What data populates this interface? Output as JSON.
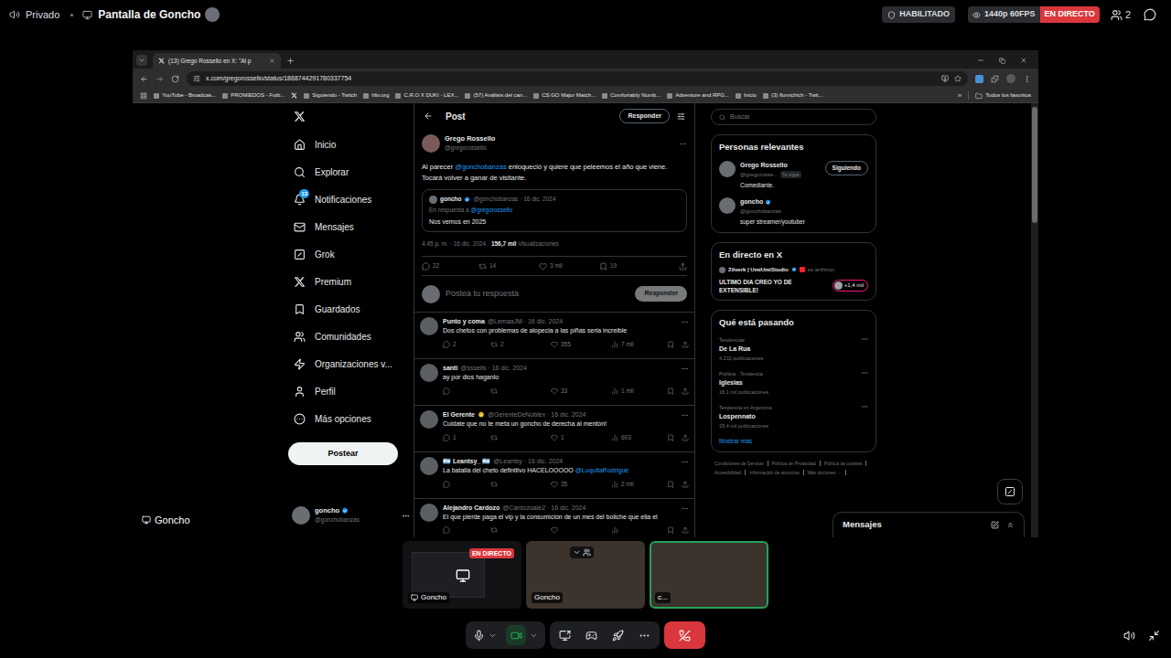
{
  "topbar": {
    "privacy": "Privado",
    "title": "Pantalla de Goncho",
    "enabled_badge": "HABILITADO",
    "quality": "1440p 60FPS",
    "live": "EN DIRECTO",
    "participants": "2"
  },
  "browser": {
    "tab": {
      "title": "(13) Grego Rossello en X: \"Al p",
      "selected": true
    },
    "url": "x.com/gregorossello/status/1868744291780337754",
    "bookmarks": [
      {
        "kind": "link",
        "label": "YouTube - Broadcas..."
      },
      {
        "kind": "link",
        "label": "PROMIEDOS - Futb..."
      },
      {
        "kind": "icon"
      },
      {
        "kind": "link",
        "label": "Siguiendo - Twitch"
      },
      {
        "kind": "link",
        "label": "hltv.org"
      },
      {
        "kind": "link",
        "label": "C.R.O X DUKI - LEX..."
      },
      {
        "kind": "link",
        "label": "(57) Análisis del can..."
      },
      {
        "kind": "link",
        "label": "CS:GO Major Match..."
      },
      {
        "kind": "link",
        "label": "Comfortably Numb..."
      },
      {
        "kind": "link",
        "label": "Adventure and RPG..."
      },
      {
        "kind": "link",
        "label": "Inicio"
      },
      {
        "kind": "link",
        "label": "(3) florvichich - Twit..."
      }
    ],
    "more": "»",
    "all_bookmarks": "Todos los favoritos",
    "scrollbar": {
      "level": 0.27
    }
  },
  "x": {
    "nav": [
      {
        "label": "Inicio"
      },
      {
        "label": "Explorar"
      },
      {
        "label": "Notificaciones",
        "badge": "13"
      },
      {
        "label": "Mensajes"
      },
      {
        "label": "Grok"
      },
      {
        "label": "Premium"
      },
      {
        "label": "Guardados"
      },
      {
        "label": "Comunidades"
      },
      {
        "label": "Organizaciones v..."
      },
      {
        "label": "Perfil"
      },
      {
        "label": "Más opciones"
      }
    ],
    "post_button": "Postear",
    "account": {
      "name": "goncho",
      "handle": "@gonchobanzas",
      "verified": true,
      "verified_color": "#1d9bf0"
    },
    "header": {
      "title": "Post",
      "reply_button": "Responder"
    },
    "tweet": {
      "name": "Grego Rossello",
      "handle": "@gregorossello",
      "text": [
        {
          "text": "Al parecer ",
          "mention": false
        },
        {
          "text": "@gonchobanzas",
          "mention": true
        },
        {
          "text": " enloqueció y quiere que peleemos el año que viene. Tocará volver a ganar de visitante.",
          "mention": false
        }
      ],
      "quote": {
        "name": "goncho",
        "verified": true,
        "verified_color": "#1d9bf0",
        "meta": "@gonchobanzas · 16 dic. 2024",
        "reply_prefix": "En respuesta a",
        "reply_handle": "@gregorossello",
        "text": "Nos vemos en 2025"
      },
      "time": "4:45 p. m. · 16 dic. 2024 ·",
      "views": "156,7 mil",
      "views_label": "Visualizaciones",
      "actions": {
        "replies": "22",
        "reposts": "14",
        "likes": "3 mil",
        "bookmarks": "19"
      }
    },
    "composer": {
      "placeholder": "Postea tu respuesta",
      "button": "Responder"
    },
    "replies": [
      {
        "name": "Punto y coma",
        "verified": false,
        "meta": "@LemaaJM · 16 dic. 2024",
        "text": [
          {
            "text": "Dos chetos con problemas de alopecia a las piñas seria increible",
            "mention": false
          }
        ],
        "replies": "2",
        "reposts": "2",
        "likes": "355",
        "views": "7 mil"
      },
      {
        "name": "santi",
        "verified": false,
        "meta": "@ssseils · 16 dic. 2024",
        "text": [
          {
            "text": "ay por dios haganlo",
            "mention": false
          }
        ],
        "replies": "",
        "reposts": "",
        "likes": "33",
        "views": "1 mil"
      },
      {
        "name": "El Gerente",
        "verified": true,
        "verified_color": "#e2b719",
        "meta": "@GerenteDeNoblex · 16 dic. 2024",
        "text": [
          {
            "text": "Cuidate que no te meta un goncho de derecha al mentón!",
            "mention": false
          }
        ],
        "replies": "1",
        "reposts": "",
        "likes": "1",
        "views": "603"
      },
      {
        "name": "🇦🇷 Leantsy_ 🇦🇷",
        "verified": false,
        "meta": "@Leantsy · 16 dic. 2024",
        "text": [
          {
            "text": "La batalla del cheto definitivo HACELOOOOO ",
            "mention": false
          },
          {
            "text": "@LuquitaRodrigue",
            "mention": true
          }
        ],
        "replies": "",
        "reposts": "",
        "likes": "35",
        "views": "2 mil"
      },
      {
        "name": "Alejandro Cardozo",
        "verified": false,
        "meta": "@Cardozoale2 · 16 dic. 2024",
        "text": [
          {
            "text": "El que pierde paga el vip y la consumicion de un mes  del boliche que elia el",
            "mention": false
          }
        ],
        "replies": "",
        "reposts": "",
        "likes": "",
        "views": ""
      }
    ],
    "sidebar": {
      "search_placeholder": "Buscar",
      "relevant": {
        "title": "Personas relevantes",
        "people": [
          {
            "name": "Grego Rossello",
            "verified": false,
            "handle": "@gregorosse...",
            "follows_you": "Te sigue",
            "button": "Siguiendo",
            "bio": "Comediante."
          },
          {
            "name": "goncho",
            "verified": true,
            "verified_color": "#1d9bf0",
            "handle": "@gonchobanzas",
            "bio": "super streamer/youtuber"
          }
        ]
      },
      "live": {
        "title": "En directo en X",
        "host": "Zilverk | UmiUmiStudio",
        "verified_color": "#1d9bf0",
        "host_label": "es anfitrión",
        "stream_title": "ULTIMO DIA CREO YO DE EXTENSIBLE!",
        "listeners": "+1,4 mil"
      },
      "trends": {
        "title": "Qué está pasando",
        "items": [
          {
            "context": "Tendencias",
            "name": "De La Rua",
            "count": "4.232 publicaciones"
          },
          {
            "context": "Política · Tendencia",
            "name": "Iglesias",
            "count": "16,1 mil publicaciones"
          },
          {
            "context": "Tendencia en Argentina",
            "name": "Lospennato",
            "count": "15,4 mil publicaciones"
          }
        ],
        "more": "Mostrar más"
      },
      "footer": [
        "Condiciones de Servicio",
        "Política de Privacidad",
        "Política de cookies",
        "Accesibilidad",
        "Información de anuncios",
        "Más opciones ···"
      ]
    },
    "messages_dock": "Mensajes"
  },
  "stage_label": "Goncho",
  "tiles": [
    {
      "kind": "screen",
      "label": "Goncho",
      "live": "EN DIRECTO",
      "selected": false
    },
    {
      "kind": "camera",
      "label": "Goncho",
      "selected": false
    },
    {
      "kind": "camera",
      "label": "c...",
      "selected": true
    }
  ],
  "controls": {
    "mic_on": true,
    "camera_on": true
  }
}
